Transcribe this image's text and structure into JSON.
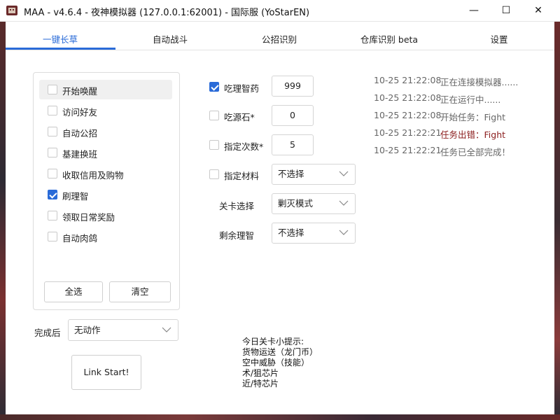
{
  "window": {
    "title": "MAA - v4.6.4 - 夜神模拟器 (127.0.0.1:62001) - 国际服 (YoStarEN)",
    "minimize_glyph": "—",
    "maximize_glyph": "☐",
    "close_glyph": "✕"
  },
  "tabs": [
    {
      "label": "一键长草",
      "active": true
    },
    {
      "label": "自动战斗",
      "active": false
    },
    {
      "label": "公招识别",
      "active": false
    },
    {
      "label": "仓库识别 beta",
      "active": false
    },
    {
      "label": "设置",
      "active": false
    }
  ],
  "tasks": [
    {
      "label": "开始唤醒",
      "checked": false,
      "highlighted": true
    },
    {
      "label": "访问好友",
      "checked": false,
      "highlighted": false
    },
    {
      "label": "自动公招",
      "checked": false,
      "highlighted": false
    },
    {
      "label": "基建换班",
      "checked": false,
      "highlighted": false
    },
    {
      "label": "收取信用及购物",
      "checked": false,
      "highlighted": false
    },
    {
      "label": "刷理智",
      "checked": true,
      "highlighted": false
    },
    {
      "label": "领取日常奖励",
      "checked": false,
      "highlighted": false
    },
    {
      "label": "自动肉鸽",
      "checked": false,
      "highlighted": false
    }
  ],
  "task_buttons": {
    "select_all": "全选",
    "clear": "清空"
  },
  "after_completion": {
    "label": "完成后",
    "value": "无动作"
  },
  "start_button": "Link Start!",
  "settings": {
    "medicine": {
      "label": "吃理智药",
      "checked": true,
      "value": "999"
    },
    "stone": {
      "label": "吃源石*",
      "checked": false,
      "value": "0"
    },
    "times": {
      "label": "指定次数*",
      "checked": false,
      "value": "5"
    },
    "material": {
      "label": "指定材料",
      "checked": false,
      "value": "不选择"
    },
    "stage": {
      "label": "关卡选择",
      "value": "剿灭模式"
    },
    "remaining": {
      "label": "剩余理智",
      "value": "不选择"
    }
  },
  "tips": {
    "heading": "今日关卡小提示:",
    "lines": [
      "货物运送（龙门币）",
      "空中威胁（技能）",
      "术/狙芯片",
      "近/特芯片"
    ]
  },
  "log": [
    {
      "time": "10-25  21:22:08",
      "message": "正在连接模拟器......",
      "error": false
    },
    {
      "time": "10-25  21:22:08",
      "message": "正在运行中......",
      "error": false
    },
    {
      "time": "10-25  21:22:08",
      "message": "开始任务：Fight",
      "error": false
    },
    {
      "time": "10-25  21:22:21",
      "message": "任务出错：Fight",
      "error": true
    },
    {
      "time": "10-25  21:22:21",
      "message": "任务已全部完成！",
      "error": false
    }
  ],
  "colors": {
    "accent": "#2a6bd8",
    "error": "#8b1d1d",
    "log_text": "#666666"
  }
}
